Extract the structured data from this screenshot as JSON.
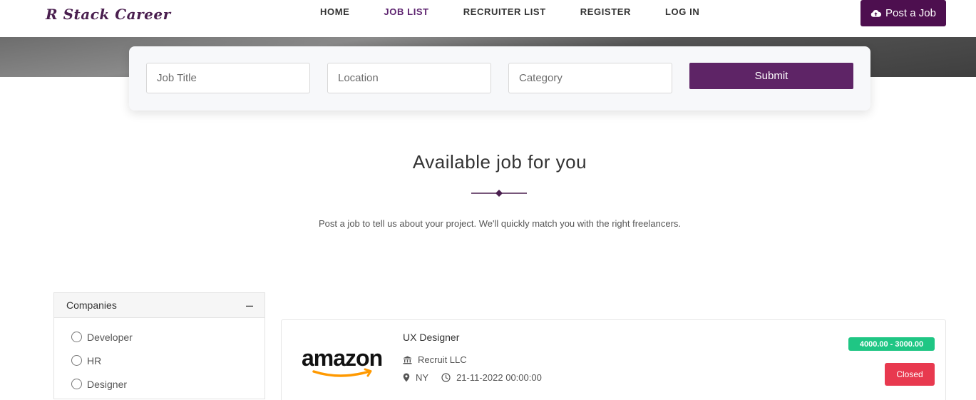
{
  "header": {
    "logo": "R Stack Career",
    "nav": [
      {
        "label": "HOME",
        "active": false
      },
      {
        "label": "JOB LIST",
        "active": true
      },
      {
        "label": "RECRUITER LIST",
        "active": false
      },
      {
        "label": "REGISTER",
        "active": false
      },
      {
        "label": "LOG IN",
        "active": false
      }
    ],
    "post_job_label": "Post a Job"
  },
  "search": {
    "job_title_placeholder": "Job Title",
    "location_placeholder": "Location",
    "category_placeholder": "Category",
    "submit_label": "Submit"
  },
  "section": {
    "title": "Available job for you",
    "subtitle": "Post a job to tell us about your project. We'll quickly match you with the right freelancers."
  },
  "sidebar": {
    "heading": "Companies",
    "collapse_symbol": "–",
    "options": [
      "Developer",
      "HR",
      "Designer"
    ]
  },
  "job": {
    "title": "UX Designer",
    "company_logo": "amazon",
    "company": "Recruit LLC",
    "location": "NY",
    "datetime": "21-11-2022 00:00:00",
    "salary": "4000.00 - 3000.00",
    "status": "Closed"
  },
  "colors": {
    "brand": "#4d0f4f",
    "active_nav": "#5e2470",
    "salary_badge": "#1fc684",
    "closed_badge": "#e8394f",
    "amazon_orange": "#ff9900"
  }
}
